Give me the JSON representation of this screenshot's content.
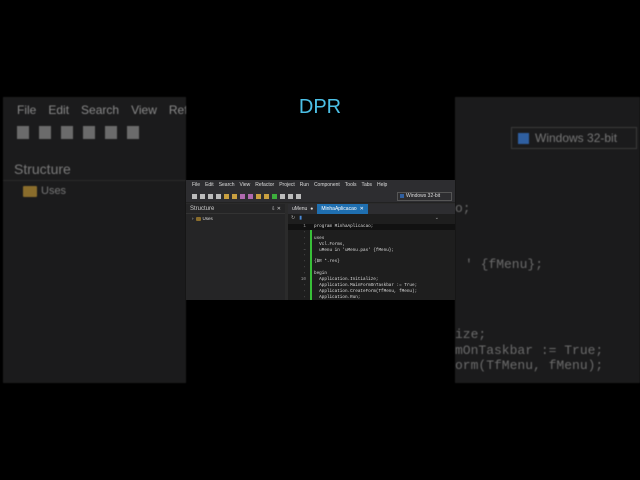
{
  "overlay_title": "DPR",
  "menu": [
    "File",
    "Edit",
    "Search",
    "View",
    "Refactor",
    "Project",
    "Run",
    "Component",
    "Tools",
    "Tabs",
    "Help"
  ],
  "platform": "Windows 32-bit",
  "structure": {
    "title": "Structure",
    "pin": "⇩",
    "close": "✕",
    "item": "Uses"
  },
  "tabs": [
    {
      "label": "uMenu",
      "mark": "●"
    },
    {
      "label": "MinhaAplicacao",
      "mark": "✕"
    }
  ],
  "code": [
    {
      "n": "1",
      "t": "program MinhaAplicacao;"
    },
    {
      "n": "·",
      "t": ""
    },
    {
      "n": "·",
      "t": "uses"
    },
    {
      "n": "·",
      "t": "  Vcl.Forms,"
    },
    {
      "n": "–",
      "t": "  uMenu in 'uMenu.pas' {fMenu};"
    },
    {
      "n": "·",
      "t": ""
    },
    {
      "n": "·",
      "t": "{$R *.res}"
    },
    {
      "n": "·",
      "t": ""
    },
    {
      "n": "·",
      "t": "begin"
    },
    {
      "n": "10",
      "t": "  Application.Initialize;"
    },
    {
      "n": "·",
      "t": "  Application.MainFormOnTaskbar := True;"
    },
    {
      "n": "·",
      "t": "  Application.CreateForm(TfMenu, fMenu);"
    },
    {
      "n": "·",
      "t": "  Application.Run;"
    }
  ],
  "bg_left": {
    "menu": [
      "File",
      "Edit",
      "Search",
      "View",
      "Refact"
    ],
    "structure": "Structure",
    "uses": "Uses"
  },
  "bg_right": {
    "platform": "Windows 32-bit",
    "lines": [
      "o;",
      "' {fMenu};",
      "ize;",
      "mOnTaskbar := True;",
      "orm(TfMenu, fMenu);"
    ]
  }
}
